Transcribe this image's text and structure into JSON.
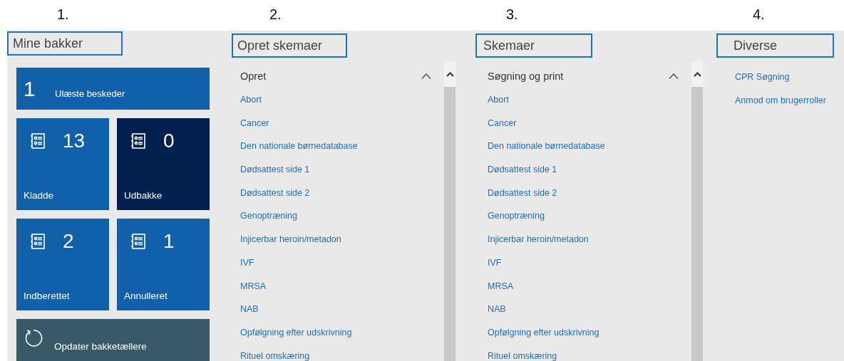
{
  "sections": [
    {
      "kind": "tiles",
      "marker": "1.",
      "title": "Mine bakker",
      "tiles": [
        {
          "kind": "wide",
          "count": "1",
          "label": "Ulæste beskeder",
          "selected": false
        },
        {
          "kind": "tray",
          "count": "13",
          "label": "Kladde",
          "selected": false
        },
        {
          "kind": "tray",
          "count": "0",
          "label": "Udbakke",
          "selected": true
        },
        {
          "kind": "tray",
          "count": "2",
          "label": "Indberettet",
          "selected": false
        },
        {
          "kind": "tray",
          "count": "1",
          "label": "Annulleret",
          "selected": false
        },
        {
          "kind": "action",
          "label": "Opdater bakketællere",
          "selected": false
        }
      ]
    },
    {
      "kind": "group",
      "marker": "2.",
      "title": "Opret skemaer",
      "group": {
        "title": "Opret",
        "expanded": true,
        "links": [
          "Abort",
          "Cancer",
          "Den nationale børnedatabase",
          "Dødsattest side 1",
          "Dødsattest side 2",
          "Genoptræning",
          "Injicerbar heroin/metadon",
          "IVF",
          "MRSA",
          "NAB",
          "Opfølgning efter udskrivning",
          "Rituel omskæring"
        ]
      }
    },
    {
      "kind": "group",
      "marker": "3.",
      "title": "Skemaer",
      "group": {
        "title": "Søgning og print",
        "expanded": true,
        "links": [
          "Abort",
          "Cancer",
          "Den nationale børnedatabase",
          "Dødsattest side 1",
          "Dødsattest side 2",
          "Genoptræning",
          "Injicerbar heroin/metadon",
          "IVF",
          "MRSA",
          "NAB",
          "Opfølgning efter udskrivning",
          "Rituel omskæring"
        ]
      }
    },
    {
      "kind": "links",
      "marker": "4.",
      "title": "Diverse",
      "links": [
        "CPR Søgning",
        "Anmod om brugerroller"
      ]
    }
  ]
}
